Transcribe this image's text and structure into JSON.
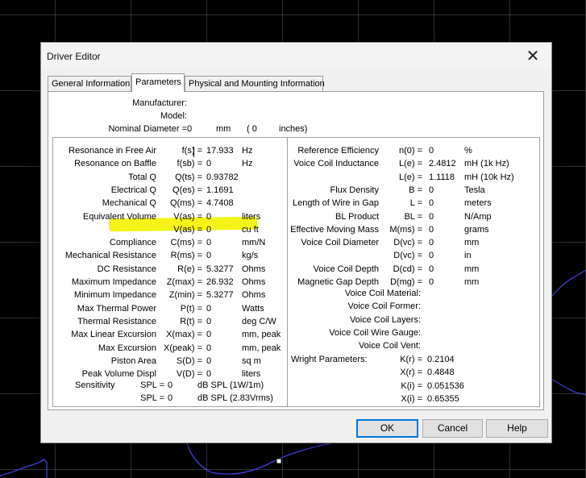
{
  "dialog": {
    "title": "Driver Editor",
    "close_glyph": "✕"
  },
  "tabs": [
    "General Information",
    "Parameters",
    "Physical and Mounting Information"
  ],
  "active_tab": "Parameters",
  "header": {
    "manufacturer": {
      "label": "Manufacturer:",
      "value": ""
    },
    "model": {
      "label": "Model:",
      "value": ""
    },
    "diameter": {
      "label": "Nominal Diameter =",
      "mm_value": "0",
      "mm_unit": "mm",
      "in_value": "( 0",
      "in_unit": "inches)"
    }
  },
  "left_params": [
    {
      "name": "Resonance in Free Air",
      "sym": "f(s) =",
      "value": "17.933",
      "unit": "Hz"
    },
    {
      "name": "Resonance on Baffle",
      "sym": "f(sb) =",
      "value": "0",
      "unit": "Hz"
    },
    {
      "name": "Total Q",
      "sym": "Q(ts) =",
      "value": "0.93782",
      "unit": ""
    },
    {
      "name": "Electrical Q",
      "sym": "Q(es) =",
      "value": "1.1691",
      "unit": ""
    },
    {
      "name": "Mechanical Q",
      "sym": "Q(ms) =",
      "value": "4.7408",
      "unit": ""
    },
    {
      "name": "Equivalent Volume",
      "sym": "V(as) =",
      "value": "0",
      "unit": "liters"
    },
    {
      "name": "",
      "sym": "V(as) =",
      "value": "0",
      "unit": "cu ft"
    },
    {
      "name": "Compliance",
      "sym": "C(ms) =",
      "value": "0",
      "unit": "mm/N"
    },
    {
      "name": "Mechanical Resistance",
      "sym": "R(ms) =",
      "value": "0",
      "unit": "kg/s"
    },
    {
      "name": "DC Resistance",
      "sym": "R(e) =",
      "value": "5.3277",
      "unit": "Ohms"
    },
    {
      "name": "Maximum Impedance",
      "sym": "Z(max) =",
      "value": "26.932",
      "unit": "Ohms"
    },
    {
      "name": "Minimum Impedance",
      "sym": "Z(min) =",
      "value": "5.3277",
      "unit": "Ohms"
    },
    {
      "name": "Max Thermal Power",
      "sym": "P(t) =",
      "value": "0",
      "unit": "Watts"
    },
    {
      "name": "Thermal Resistance",
      "sym": "R(t) =",
      "value": "0",
      "unit": "deg C/W"
    },
    {
      "name": "Max Linear Excursion",
      "sym": "X(max) =",
      "value": "0",
      "unit": "mm, peak"
    },
    {
      "name": "Max Excursion",
      "sym": "X(peak) =",
      "value": "0",
      "unit": "mm, peak"
    },
    {
      "name": "Piston Area",
      "sym": "S(D) =",
      "value": "0",
      "unit": "sq m"
    },
    {
      "name": "Peak Volume Displ",
      "sym": "V(D) =",
      "value": "0",
      "unit": "liters"
    }
  ],
  "sensitivity": {
    "label": "Sensitivity",
    "rows": [
      {
        "sym": "SPL =",
        "value": "0",
        "unit": "dB SPL (1W/1m)"
      },
      {
        "sym": "SPL =",
        "value": "0",
        "unit": "dB SPL (2.83Vrms)"
      }
    ]
  },
  "right_params": [
    {
      "name": "Reference Efficiency",
      "sym": "n(0) =",
      "value": "0",
      "unit": "%"
    },
    {
      "name": "Voice Coil Inductance",
      "sym": "L(e) =",
      "value": "2.4812",
      "unit": "mH (1k Hz)"
    },
    {
      "name": "",
      "sym": "L(e) =",
      "value": "1.1118",
      "unit": "mH (10k Hz)"
    },
    {
      "name": "Flux Density",
      "sym": "B =",
      "value": "0",
      "unit": "Tesla"
    },
    {
      "name": "Length of Wire in Gap",
      "sym": "L =",
      "value": "0",
      "unit": "meters"
    },
    {
      "name": "BL Product",
      "sym": "BL =",
      "value": "0",
      "unit": "N/Amp"
    },
    {
      "name": "Effective Moving Mass",
      "sym": "M(ms) =",
      "value": "0",
      "unit": "grams"
    },
    {
      "name": "Voice Coil Diameter",
      "sym": "D(vc) =",
      "value": "0",
      "unit": "mm"
    },
    {
      "name": "",
      "sym": "D(vc) =",
      "value": "0",
      "unit": "in"
    },
    {
      "name": "Voice Coil Depth",
      "sym": "D(cd) =",
      "value": "0",
      "unit": "mm"
    },
    {
      "name": "Magnetic Gap Depth",
      "sym": "D(mg) =",
      "value": "0",
      "unit": "mm"
    }
  ],
  "voice_coil_labels": [
    "Voice Coil Material:",
    "Voice Coil Former:",
    "Voice Coil Layers:",
    "Voice Coil Wire Gauge:",
    "Voice Coil Vent:"
  ],
  "wright": {
    "label": "Wright Parameters:",
    "rows": [
      {
        "sym": "K(r) =",
        "value": "0.2104"
      },
      {
        "sym": "X(r) =",
        "value": "0.4848"
      },
      {
        "sym": "K(i) =",
        "value": "0.051536"
      },
      {
        "sym": "X(i) =",
        "value": "0.65355"
      }
    ]
  },
  "buttons": {
    "ok": "OK",
    "cancel": "Cancel",
    "help": "Help"
  },
  "colors": {
    "highlight": "#f5f31a",
    "curve": "#3e3ed8",
    "ok_border": "#0078d7"
  }
}
